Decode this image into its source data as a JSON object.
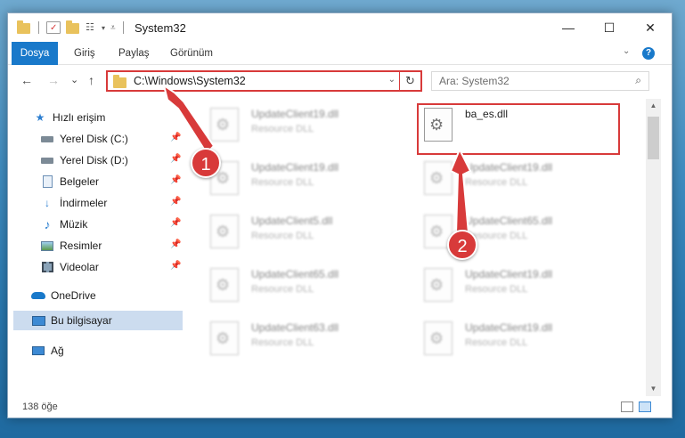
{
  "window": {
    "title": "System32",
    "minimize_glyph": "—",
    "maximize_glyph": "☐",
    "close_glyph": "✕"
  },
  "ribbon": {
    "tabs": [
      "Dosya",
      "Giriş",
      "Paylaş",
      "Görünüm"
    ],
    "help": "?"
  },
  "nav": {
    "back": "←",
    "forward": "→",
    "recent": "⌄",
    "up": "↑",
    "address_path": "C:\\Windows\\System32",
    "refresh": "↻",
    "search_placeholder": "Ara: System32"
  },
  "sidebar": {
    "items": [
      {
        "label": "Hızlı erişim",
        "icon": "star-icon",
        "pinned": false
      },
      {
        "label": "Yerel Disk (C:)",
        "icon": "drive-icon",
        "pinned": true
      },
      {
        "label": "Yerel Disk (D:)",
        "icon": "drive-icon",
        "pinned": true
      },
      {
        "label": "Belgeler",
        "icon": "document-icon",
        "pinned": true
      },
      {
        "label": "İndirmeler",
        "icon": "download-icon",
        "pinned": true
      },
      {
        "label": "Müzik",
        "icon": "music-icon",
        "pinned": true
      },
      {
        "label": "Resimler",
        "icon": "pictures-icon",
        "pinned": true
      },
      {
        "label": "Videolar",
        "icon": "video-icon",
        "pinned": true
      },
      {
        "label": "OneDrive",
        "icon": "cloud-icon",
        "pinned": false
      },
      {
        "label": "Bu bilgisayar",
        "icon": "computer-icon",
        "pinned": false
      },
      {
        "label": "Ağ",
        "icon": "network-icon",
        "pinned": false
      }
    ]
  },
  "files": [
    {
      "name": "UpdateClient19.dll",
      "type": "Resource DLL"
    },
    {
      "name": "ba_es.dll",
      "type": ""
    },
    {
      "name": "UpdateClient19.dll",
      "type": "Resource DLL"
    },
    {
      "name": "UpdateClient19.dll",
      "type": "Resource DLL"
    },
    {
      "name": "UpdateClient5.dll",
      "type": "Resource DLL"
    },
    {
      "name": "UpdateClient65.dll",
      "type": "Resource DLL"
    },
    {
      "name": "UpdateClient65.dll",
      "type": "Resource DLL"
    },
    {
      "name": "UpdateClient19.dll",
      "type": "Resource DLL"
    },
    {
      "name": "UpdateClient63.dll",
      "type": "Resource DLL"
    },
    {
      "name": "UpdateClient19.dll",
      "type": "Resource DLL"
    }
  ],
  "status": {
    "item_count": "138 öğe"
  },
  "annotations": {
    "step1": "1",
    "step2": "2",
    "color": "#d83a3a"
  }
}
